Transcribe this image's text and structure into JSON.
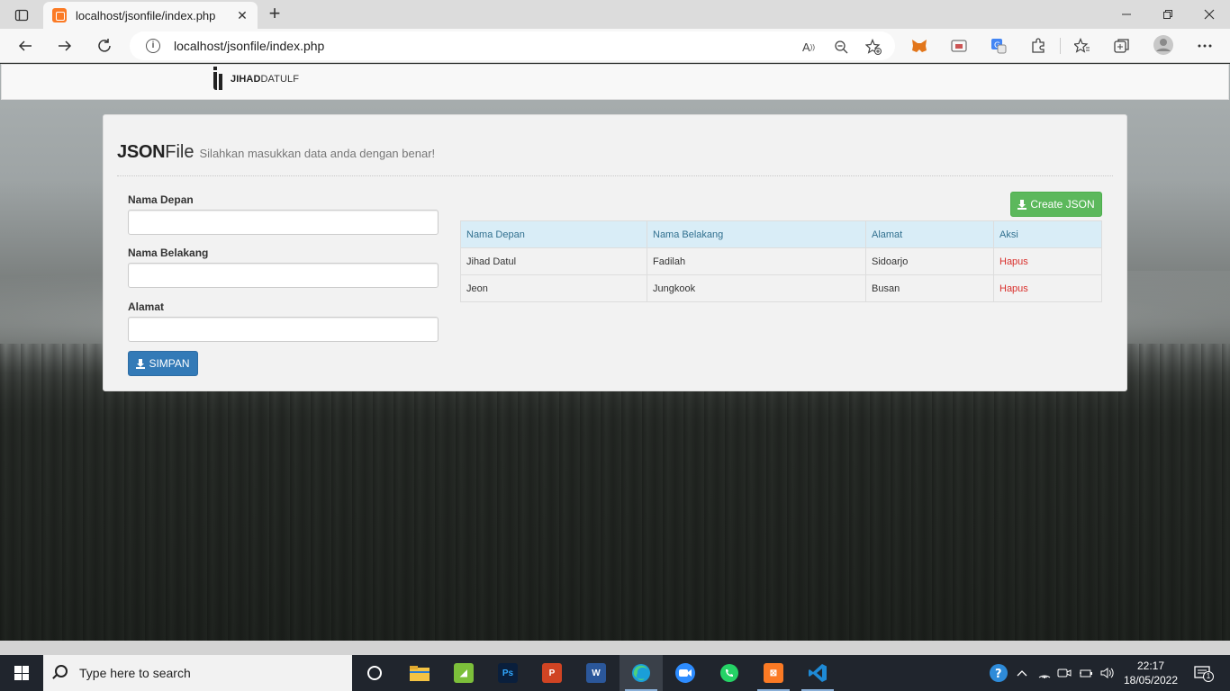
{
  "browser": {
    "tab_title": "localhost/jsonfile/index.php",
    "tab_close": "✕",
    "new_tab": "+",
    "url": "localhost/jsonfile/index.php",
    "icons": [
      "tab-actions-icon",
      "back-icon",
      "forward-icon",
      "refresh-icon",
      "info-icon",
      "read-aloud-icon",
      "zoom-out-icon",
      "add-favorite-icon",
      "metamask-extension-icon",
      "screenshot-extension-icon",
      "translate-extension-icon",
      "extensions-icon",
      "favorites-icon",
      "collections-icon",
      "profile-icon",
      "more-icon"
    ]
  },
  "site": {
    "brand_bold": "JIHAD",
    "brand_rest": "DATULF",
    "heading_strong": "JSON",
    "heading_light": "File",
    "heading_sub": "Silahkan masukkan data anda dengan benar!",
    "form": {
      "nama_depan_label": "Nama Depan",
      "nama_depan_value": "",
      "nama_belakang_label": "Nama Belakang",
      "nama_belakang_value": "",
      "alamat_label": "Alamat",
      "alamat_value": "",
      "submit_label": "SIMPAN"
    },
    "create_json_label": "Create JSON",
    "table": {
      "headers": [
        "Nama Depan",
        "Nama Belakang",
        "Alamat",
        "Aksi"
      ],
      "rows": [
        [
          "Jihad Datul",
          "Fadilah",
          "Sidoarjo",
          "Hapus"
        ],
        [
          "Jeon",
          "Jungkook",
          "Busan",
          "Hapus"
        ]
      ]
    },
    "colors": {
      "primary": "#337ab7",
      "success": "#5cb85c",
      "danger": "#d9302c",
      "table_head": "#d9edf7"
    }
  },
  "taskbar": {
    "search_placeholder": "Type here to search",
    "time": "22:17",
    "date": "18/05/2022",
    "notification_count": "1",
    "apps": [
      "cortana",
      "file-explorer",
      "inkscape",
      "photoshop",
      "powerpoint",
      "word",
      "edge",
      "zoom",
      "whatsapp",
      "xampp",
      "vscode"
    ]
  }
}
